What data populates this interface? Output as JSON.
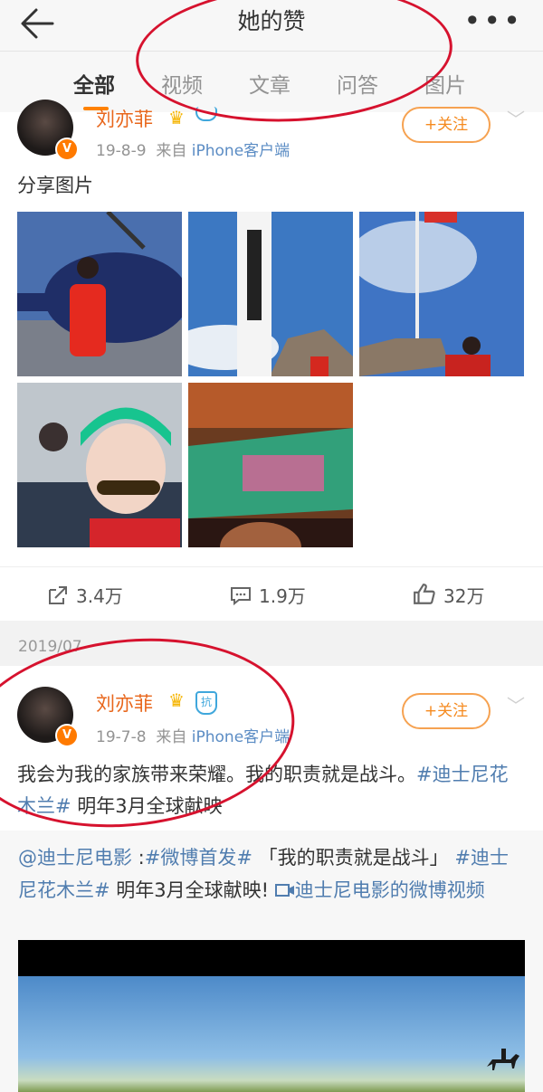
{
  "header": {
    "title": "她的赞",
    "more": "•••"
  },
  "tabs": [
    {
      "label": "全部",
      "active": true
    },
    {
      "label": "视频",
      "active": false
    },
    {
      "label": "文章",
      "active": false
    },
    {
      "label": "问答",
      "active": false
    },
    {
      "label": "图片",
      "active": false
    }
  ],
  "post1": {
    "name": "刘亦菲",
    "date": "19-8-9",
    "from": "来自",
    "source": "iPhone客户端",
    "follow": "+关注",
    "text": "分享图片",
    "photos": [
      "helicopter-photo",
      "tissot-banner-photo",
      "flag-photo",
      "helicopter-cabin-photo",
      "stadium-photo"
    ],
    "repost_count": "3.4万",
    "comment_count": "1.9万",
    "like_count": "32万"
  },
  "date_separator": "2019/07",
  "post2": {
    "name": "刘亦菲",
    "badge": "抗",
    "date": "19-7-8",
    "from": "来自",
    "source": "iPhone客户端",
    "follow": "+关注",
    "text_plain": "我会为我的家族带来荣耀。我的职责就是战斗。",
    "topic1": "#迪士尼花木兰#",
    "text_tail": " 明年3月全球献映"
  },
  "repost": {
    "mention": "@迪士尼电影",
    "colon": " :",
    "topic1": "#微博首发#",
    "quote": " 「我的职责就是战斗」",
    "topic2": "#迪士尼花木兰#",
    "tail": " 明年3月全球献映! ",
    "video_link": "迪士尼电影的微博视频"
  },
  "colors": {
    "accent": "#ff8200",
    "link": "#507daf",
    "annotation": "#d6122e"
  }
}
